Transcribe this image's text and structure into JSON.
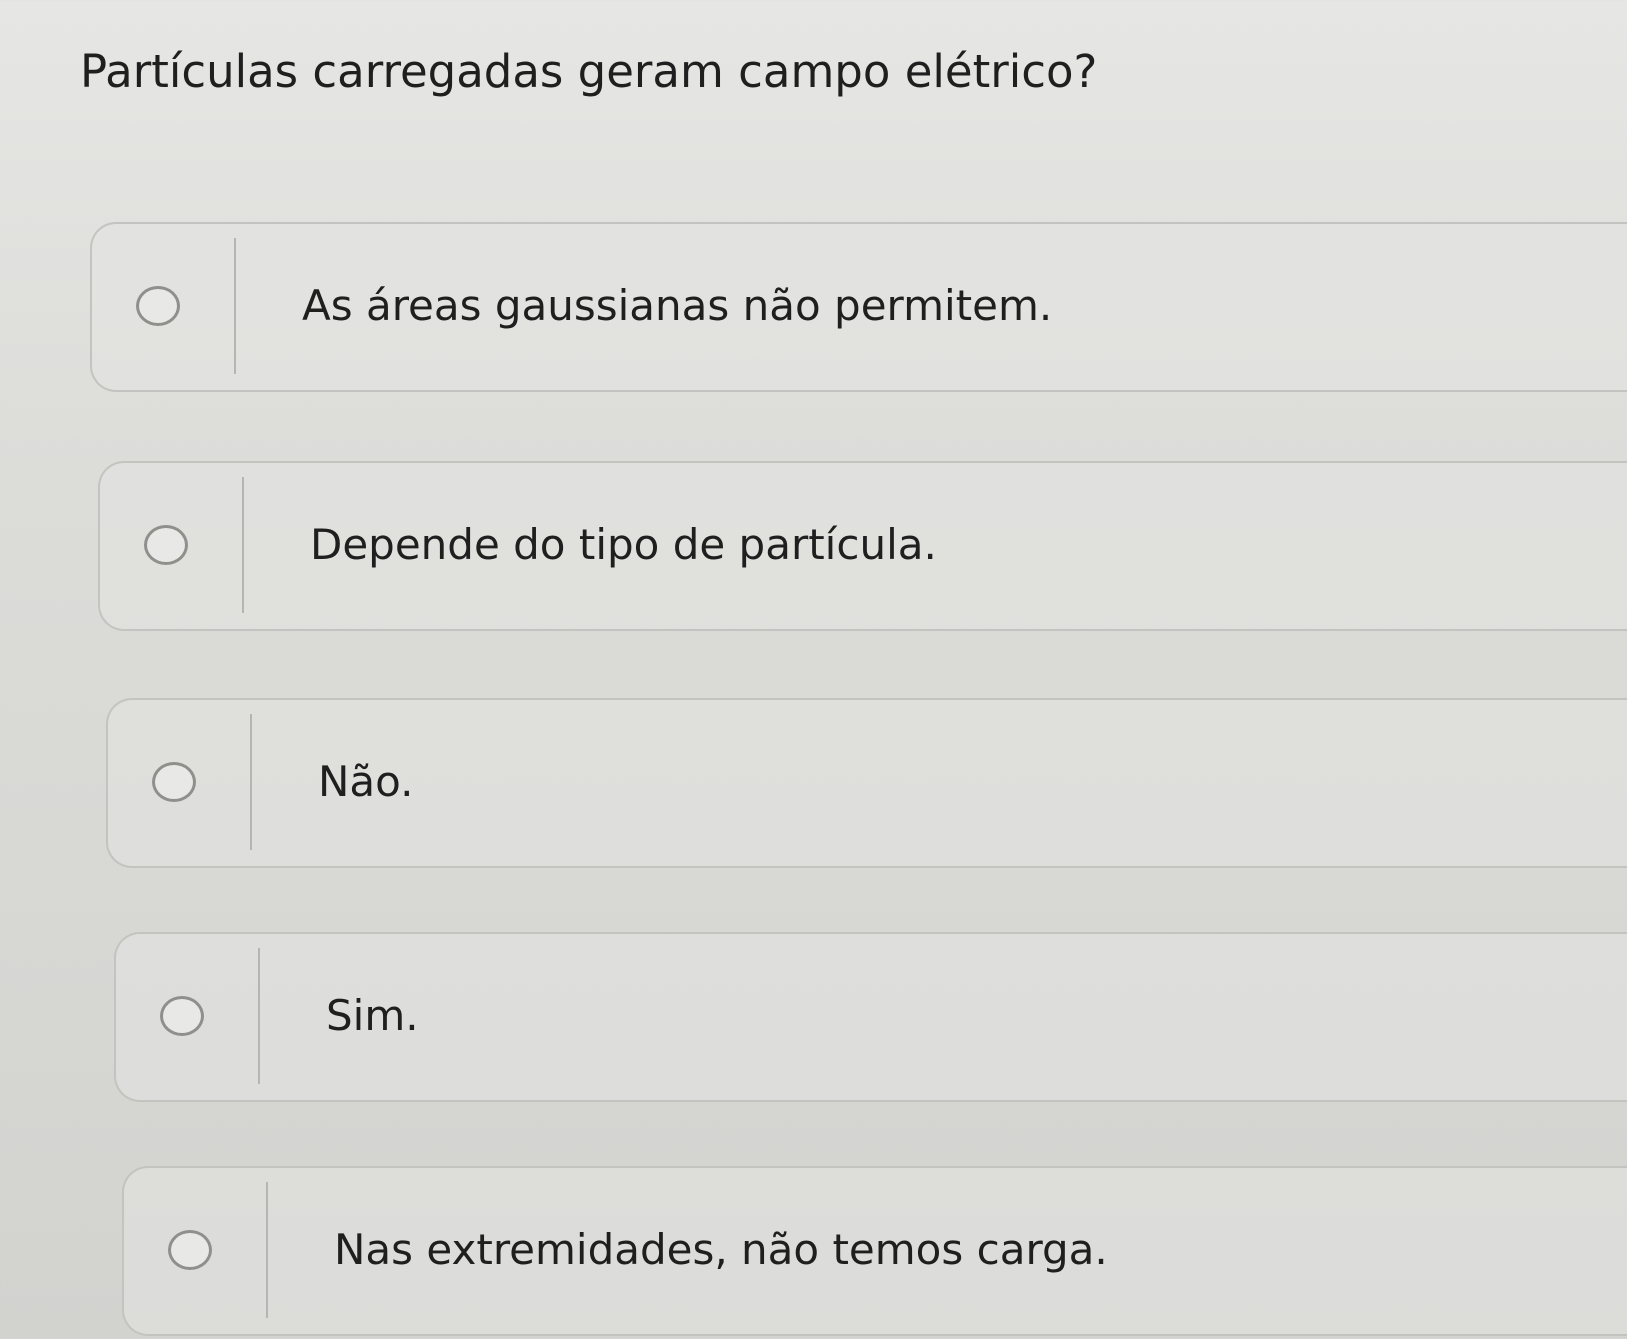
{
  "question": {
    "text": "Partículas carregadas geram campo elétrico?"
  },
  "options": [
    {
      "label": "As áreas gaussianas não permitem.",
      "selected": false
    },
    {
      "label": "Depende do tipo de partícula.",
      "selected": false
    },
    {
      "label": "Não.",
      "selected": false
    },
    {
      "label": "Sim.",
      "selected": false
    },
    {
      "label": "Nas extremidades, não temos carga.",
      "selected": false
    }
  ]
}
